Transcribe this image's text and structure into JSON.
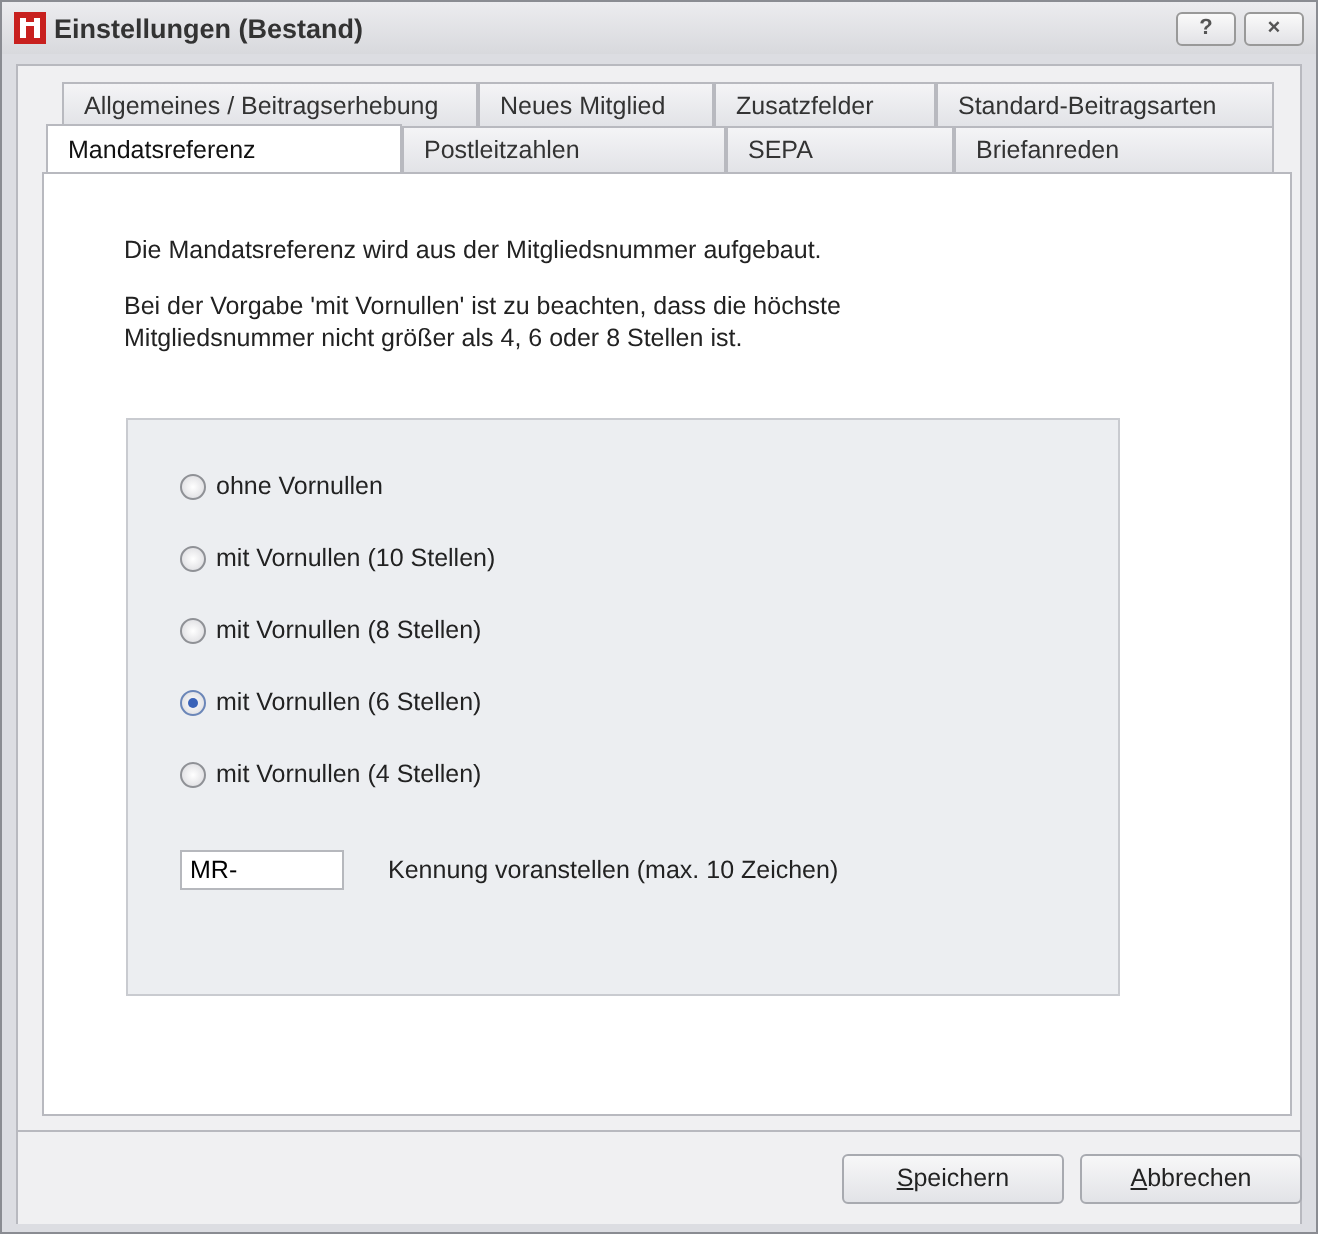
{
  "window": {
    "title": "Einstellungen (Bestand)",
    "buttons": [
      "?",
      "×"
    ]
  },
  "tab_rows": [
    [
      {
        "label": "Allgemeines / Beitragserhebung",
        "selected": false
      },
      {
        "label": "Neues Mitglied",
        "selected": false
      },
      {
        "label": "Zusatzfelder",
        "selected": false
      },
      {
        "label": "Standard-Beitragsarten",
        "selected": false
      }
    ],
    [
      {
        "label": "Mandatsreferenz",
        "selected": true
      },
      {
        "label": "Postleitzahlen",
        "selected": false
      },
      {
        "label": "SEPA",
        "selected": false
      },
      {
        "label": "Briefanreden",
        "selected": false
      }
    ]
  ],
  "intro": "Die Mandatsreferenz wird aus der Mitgliedsnummer aufgebaut.",
  "note": "Bei der Vorgabe 'mit Vornullen' ist zu beachten, dass die höchste Mitgliedsnummer nicht größer als 4, 6 oder 8 Stellen ist.",
  "options": [
    {
      "label": "ohne Vornullen",
      "selected": false
    },
    {
      "label": "mit Vornullen (10 Stellen)",
      "selected": false
    },
    {
      "label": "mit Vornullen (8 Stellen)",
      "selected": false
    },
    {
      "label": "mit Vornullen (6 Stellen)",
      "selected": true
    },
    {
      "label": "mit Vornullen (4 Stellen)",
      "selected": false
    }
  ],
  "prefix": {
    "value": "MR-",
    "label": "Kennung voranstellen (max. 10 Zeichen)"
  },
  "buttons": [
    {
      "label": "Speichern"
    },
    {
      "label": "Abbrechen"
    }
  ]
}
